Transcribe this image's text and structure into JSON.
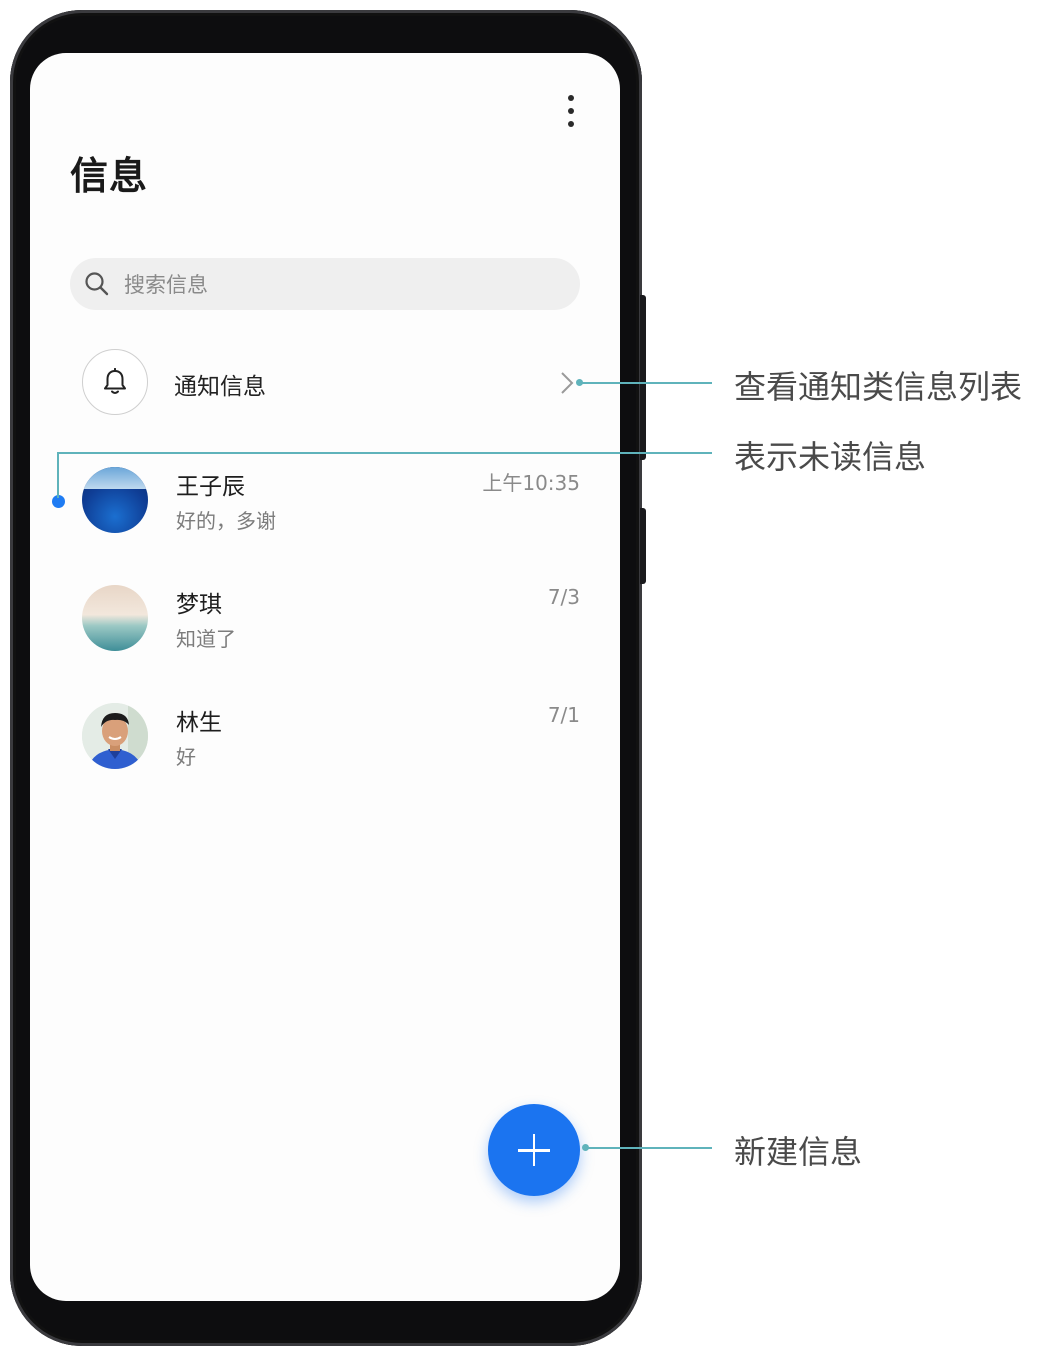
{
  "app": {
    "title": "信息",
    "menu_icon": "more-vertical-icon"
  },
  "search": {
    "placeholder": "搜索信息",
    "icon": "search-icon"
  },
  "notification_row": {
    "label": "通知信息",
    "icon": "bell-icon"
  },
  "conversations": [
    {
      "name": "王子辰",
      "preview": "好的，多谢",
      "time": "上午10:35",
      "unread": true
    },
    {
      "name": "梦琪",
      "preview": "知道了",
      "time": "7/3",
      "unread": false
    },
    {
      "name": "林生",
      "preview": "好",
      "time": "7/1",
      "unread": false
    }
  ],
  "fab": {
    "icon": "plus-icon"
  },
  "annotations": {
    "notification_list": "查看通知类信息列表",
    "unread": "表示未读信息",
    "new_message": "新建信息"
  },
  "colors": {
    "accent": "#1b74f0",
    "unread_dot": "#1f7cf3",
    "callout_line": "#5fb3bb"
  }
}
